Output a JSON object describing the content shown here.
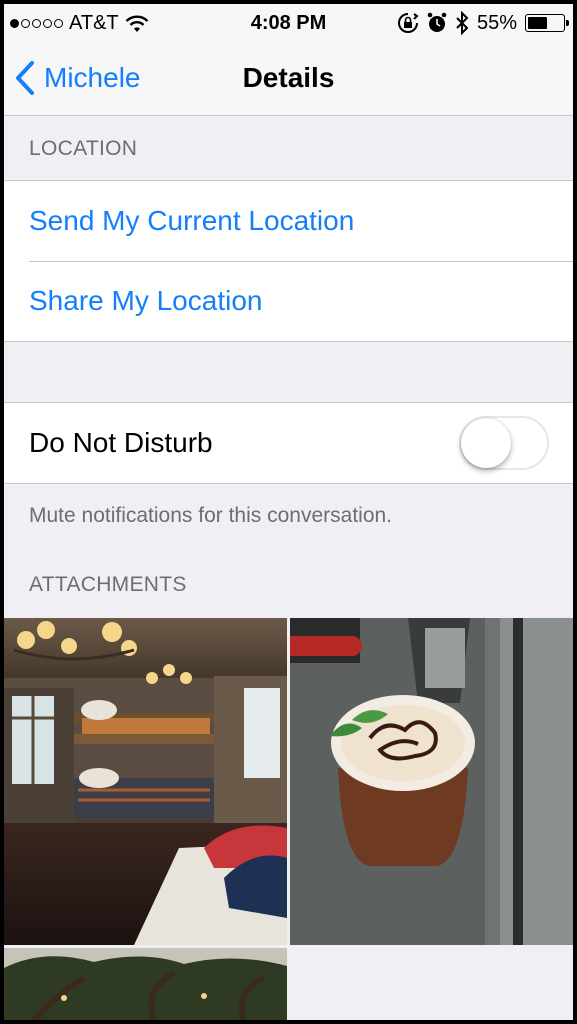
{
  "status_bar": {
    "carrier": "AT&T",
    "signal_filled": 1,
    "signal_total": 5,
    "time": "4:08 PM",
    "battery_percent": "55%",
    "battery_level": 0.55,
    "icons": [
      "wifi-icon",
      "rotation-lock-icon",
      "alarm-icon",
      "bluetooth-icon"
    ]
  },
  "nav": {
    "back_label": "Michele",
    "title": "Details"
  },
  "location": {
    "header": "LOCATION",
    "send_current": "Send My Current Location",
    "share": "Share My Location"
  },
  "dnd": {
    "label": "Do Not Disturb",
    "enabled": false,
    "note": "Mute notifications for this conversation."
  },
  "attachments": {
    "header": "ATTACHMENTS",
    "items": [
      "cabin-bunk-room-photo",
      "iced-coffee-photo",
      "trees-at-dusk-photo"
    ]
  },
  "colors": {
    "accent": "#157efb",
    "background": "#efeff4",
    "secondary_text": "#6d6d72"
  }
}
